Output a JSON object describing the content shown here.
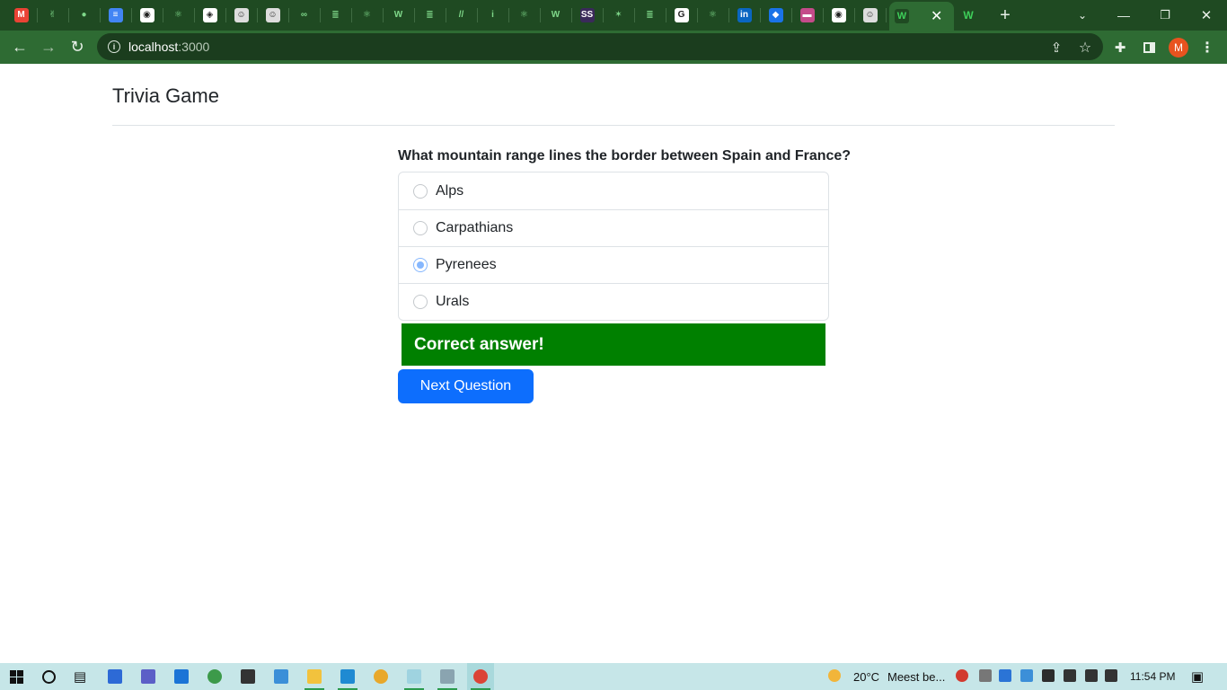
{
  "browser": {
    "tabs": [
      {
        "icon": "gmail-icon",
        "color": "#ea4335",
        "glyph": "M"
      },
      {
        "icon": "hand-icon",
        "color": "#1f4a22",
        "glyph": "✌"
      },
      {
        "icon": "github-icon",
        "color": "#1f4a22",
        "glyph": "●"
      },
      {
        "icon": "docs-icon",
        "color": "#4285f4",
        "glyph": "≡"
      },
      {
        "icon": "globe-icon",
        "color": "#ffffff",
        "glyph": "◉"
      },
      {
        "icon": "react-icon",
        "color": "#1f4a22",
        "glyph": "⚛"
      },
      {
        "icon": "codepen-icon",
        "color": "#ffffff",
        "glyph": "◈"
      },
      {
        "icon": "avatar-icon",
        "color": "#dddddd",
        "glyph": "☺"
      },
      {
        "icon": "avatar-icon",
        "color": "#dddddd",
        "glyph": "☺"
      },
      {
        "icon": "geeksforgeeks-icon",
        "color": "#1f4a22",
        "glyph": "∞"
      },
      {
        "icon": "stackoverflow-icon",
        "color": "#1f4a22",
        "glyph": "≣"
      },
      {
        "icon": "react-icon",
        "color": "#1f4a22",
        "glyph": "⚛"
      },
      {
        "icon": "w-icon",
        "color": "#1f4a22",
        "glyph": "W"
      },
      {
        "icon": "stackoverflow-icon",
        "color": "#1f4a22",
        "glyph": "≣"
      },
      {
        "icon": "slash-icon",
        "color": "#1f4a22",
        "glyph": "//"
      },
      {
        "icon": "info-icon",
        "color": "#1f4a22",
        "glyph": "i"
      },
      {
        "icon": "react-icon",
        "color": "#1f4a22",
        "glyph": "⚛"
      },
      {
        "icon": "w-icon",
        "color": "#1f4a22",
        "glyph": "W"
      },
      {
        "icon": "ss-icon",
        "color": "#3a2a5a",
        "glyph": "SS"
      },
      {
        "icon": "star-icon",
        "color": "#1f4a22",
        "glyph": "✶"
      },
      {
        "icon": "stackoverflow-icon",
        "color": "#1f4a22",
        "glyph": "≣"
      },
      {
        "icon": "google-icon",
        "color": "#ffffff",
        "glyph": "G"
      },
      {
        "icon": "react-icon",
        "color": "#1f4a22",
        "glyph": "⚛"
      },
      {
        "icon": "linkedin-icon",
        "color": "#0a66c2",
        "glyph": "in"
      },
      {
        "icon": "diamond-icon",
        "color": "#1a73e8",
        "glyph": "◆"
      },
      {
        "icon": "flag-icon",
        "color": "#c44b8a",
        "glyph": "▬"
      },
      {
        "icon": "globe-icon",
        "color": "#ffffff",
        "glyph": "◉"
      },
      {
        "icon": "avatar-icon",
        "color": "#dddddd",
        "glyph": "☺"
      },
      {
        "icon": "chrome-icon",
        "color": "#fbbc04",
        "glyph": "◎"
      }
    ],
    "active_tab": {
      "icon": "w-icon",
      "glyph": "W"
    },
    "url_host": "localhost",
    "url_port": ":3000",
    "profile_initial": "M"
  },
  "app": {
    "title": "Trivia Game",
    "question": "What mountain range lines the border between Spain and France?",
    "options": [
      {
        "label": "Alps",
        "selected": false
      },
      {
        "label": "Carpathians",
        "selected": false
      },
      {
        "label": "Pyrenees",
        "selected": true
      },
      {
        "label": "Urals",
        "selected": false
      }
    ],
    "feedback": "Correct answer!",
    "feedback_color": "#008000",
    "next_button": "Next Question",
    "accent_color": "#0d6efd"
  },
  "taskbar": {
    "weather_temp": "20°C",
    "weather_text": "Meest be...",
    "clock": "11:54 PM"
  }
}
